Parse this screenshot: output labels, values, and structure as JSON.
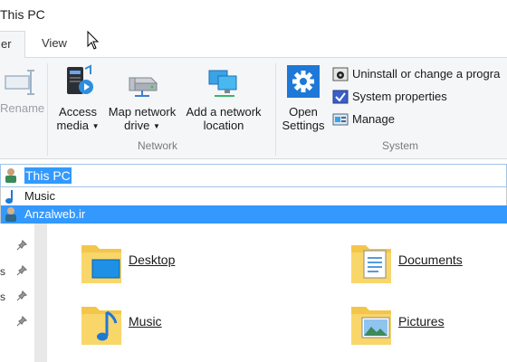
{
  "window": {
    "title": "This PC"
  },
  "tabs": [
    {
      "label": "er",
      "active": true
    },
    {
      "label": "View",
      "active": false
    }
  ],
  "ribbon": {
    "rename": {
      "label": "Rename",
      "icon": "rename-icon"
    },
    "network_group": {
      "label": "Network",
      "buttons": [
        {
          "line1": "Access",
          "line2": "media",
          "icon": "access-media-icon"
        },
        {
          "line1": "Map network",
          "line2": "drive",
          "icon": "map-network-drive-icon"
        },
        {
          "line1": "Add a network",
          "line2": "location",
          "icon": "add-network-location-icon"
        }
      ]
    },
    "system_group": {
      "label": "System",
      "open_settings": {
        "line1": "Open",
        "line2": "Settings",
        "icon": "gear-icon"
      },
      "items": [
        {
          "label": "Uninstall or change a progra",
          "icon": "uninstall-icon"
        },
        {
          "label": "System properties",
          "icon": "system-properties-icon"
        },
        {
          "label": "Manage",
          "icon": "manage-icon"
        }
      ]
    }
  },
  "address_bar": {
    "value": "This PC",
    "icon": "this-pc-icon"
  },
  "dropdown": {
    "items": [
      {
        "label": "Music",
        "icon": "music-note-icon",
        "selected": false
      },
      {
        "label": "Anzalweb.ir",
        "icon": "user-icon",
        "selected": true
      }
    ]
  },
  "nav_pane": {
    "marks": [
      "s",
      "s"
    ]
  },
  "folders": [
    {
      "label": "Desktop",
      "icon": "desktop-folder-icon"
    },
    {
      "label": "Documents",
      "icon": "documents-folder-icon"
    },
    {
      "label": "Music",
      "icon": "music-folder-icon"
    },
    {
      "label": "Pictures",
      "icon": "pictures-folder-icon"
    }
  ],
  "colors": {
    "selection": "#3399ff",
    "ribbon_bg": "#f5f6f7",
    "gear_blue": "#1e78d7",
    "folder_yellow": "#f3c64a"
  }
}
